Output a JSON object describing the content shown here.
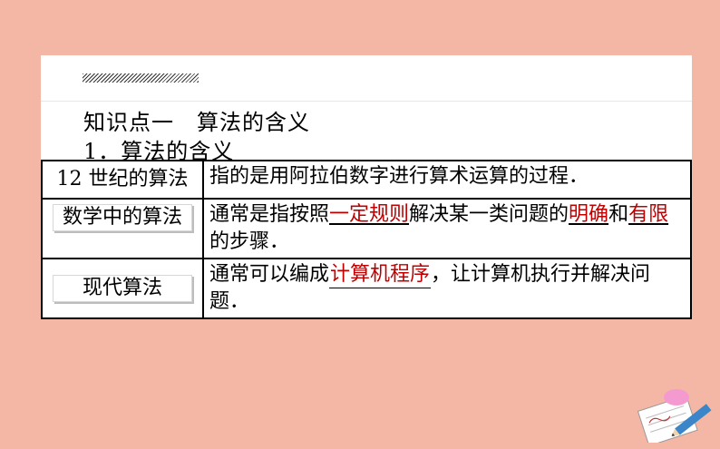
{
  "heading": "知识点一　算法的含义",
  "subheading": "1．算法的含义",
  "table": {
    "rows": [
      {
        "label": "12 世纪的算法",
        "text_a": "指的是用阿拉伯数字进行算术运算的过程．"
      },
      {
        "label": "数学中的算法",
        "text_a": "通常是指按照",
        "blank_1": "一定规则",
        "text_b": "解决某一类问题的",
        "blank_2": "明确",
        "text_c": "和",
        "blank_3": "有限",
        "text_d": "的步骤．"
      },
      {
        "label": "现代算法",
        "text_a": "通常可以编成",
        "blank_1": "计算机程序",
        "text_b": "，让计算机执行并解决问题．"
      }
    ]
  },
  "decoration": {
    "icon": "paper-and-pencil-icon",
    "badge_color": "#f59ad0",
    "pencil_color": "#3a86c8"
  }
}
